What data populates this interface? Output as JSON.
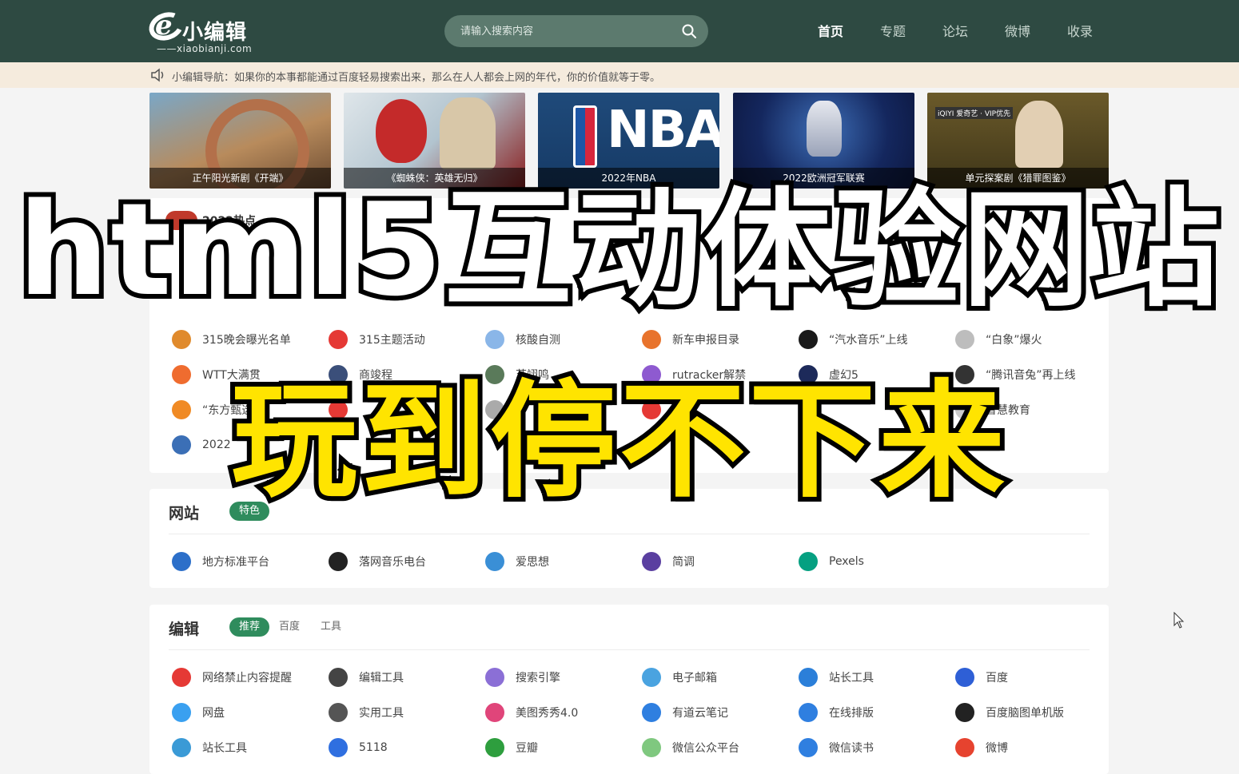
{
  "header": {
    "logo_text": "小编辑",
    "logo_sub": "——xiaobianji.com",
    "search_placeholder": "请输入搜索内容",
    "nav": [
      "首页",
      "专题",
      "论坛",
      "微博",
      "收录"
    ]
  },
  "notice": {
    "text": "小编辑导航：如果你的本事都能通过百度轻易搜索出来，那么在人人都会上网的年代，你的价值就等于零。"
  },
  "banners": [
    {
      "caption": "正午阳光新剧《开端》"
    },
    {
      "caption": "《蜘蛛侠：英雄无归》"
    },
    {
      "caption": "2022年NBA",
      "mark": "NBA"
    },
    {
      "caption": "2022欧洲冠军联赛"
    },
    {
      "caption": "单元探案剧《猎罪图鉴》",
      "mark": "iQIYI 爱奇艺 · VIP优先"
    }
  ],
  "hot": {
    "title": "2022热点",
    "items": [
      {
        "label": "315晚会曝光名单",
        "color": "#e08a2c"
      },
      {
        "label": "315主题活动",
        "color": "#e53935"
      },
      {
        "label": "核酸自测",
        "color": "#8ab6e8"
      },
      {
        "label": "新车申报目录",
        "color": "#e8732c"
      },
      {
        "label": "“汽水音乐”上线",
        "color": "#1a1a1a"
      },
      {
        "label": "“白象”爆火",
        "color": "#bdbdbd"
      },
      {
        "label": "WTT大满贯",
        "color": "#ef6c2f"
      },
      {
        "label": "商竣程",
        "color": "#3b4f7a"
      },
      {
        "label": "苏翊鸣",
        "color": "#5a7a5a"
      },
      {
        "label": "rutracker解禁",
        "color": "#8e5ad0"
      },
      {
        "label": "虚幻5",
        "color": "#1d2a5a"
      },
      {
        "label": "“腾讯音兔”再上线",
        "color": "#333333"
      },
      {
        "label": "“东方甄选”",
        "color": "#f08a24"
      },
      {
        "label": "",
        "color": "#e53935"
      },
      {
        "label": "",
        "color": "#aaaaaa"
      },
      {
        "label": "",
        "color": "#e53935"
      },
      {
        "label": "",
        "color": "#cccccc"
      },
      {
        "label": "智慧教育",
        "color": "#cccccc"
      },
      {
        "label": "2022",
        "color": "#3b6fb6"
      }
    ]
  },
  "sites": {
    "title": "网站",
    "tab": "特色",
    "items": [
      {
        "label": "地方标准平台",
        "color": "#2c6fc9"
      },
      {
        "label": "落网音乐电台",
        "color": "#222222"
      },
      {
        "label": "爱思想",
        "color": "#3a8fd6"
      },
      {
        "label": "简调",
        "color": "#5a3fa0"
      },
      {
        "label": "Pexels",
        "color": "#05a081"
      }
    ]
  },
  "editor": {
    "title": "编辑",
    "tabs": [
      "推荐",
      "百度",
      "工具"
    ],
    "items": [
      {
        "label": "网络禁止内容提醒",
        "color": "#e53935"
      },
      {
        "label": "编辑工具",
        "color": "#444444"
      },
      {
        "label": "搜索引擎",
        "color": "#8b6fd6"
      },
      {
        "label": "电子邮箱",
        "color": "#4aa3e0"
      },
      {
        "label": "站长工具",
        "color": "#2b7fd9"
      },
      {
        "label": "百度",
        "color": "#2e5fd6"
      },
      {
        "label": "网盘",
        "color": "#3aa0f0"
      },
      {
        "label": "实用工具",
        "color": "#555555"
      },
      {
        "label": "美图秀秀4.0",
        "color": "#e0457a"
      },
      {
        "label": "有道云笔记",
        "color": "#2f7fe0"
      },
      {
        "label": "在线排版",
        "color": "#2f7fe0"
      },
      {
        "label": "百度脑图单机版",
        "color": "#222222"
      },
      {
        "label": "站长工具",
        "color": "#3a9ad6"
      },
      {
        "label": "5118",
        "color": "#2f6fe0"
      },
      {
        "label": "豆瓣",
        "color": "#2e9e3e"
      },
      {
        "label": "微信公众平台",
        "color": "#7fc87f"
      },
      {
        "label": "微信读书",
        "color": "#2f7fe0"
      },
      {
        "label": "微博",
        "color": "#e6432f"
      }
    ]
  },
  "overlay": {
    "line1": "html5互动体验网站",
    "line2": "玩到停不下来"
  }
}
